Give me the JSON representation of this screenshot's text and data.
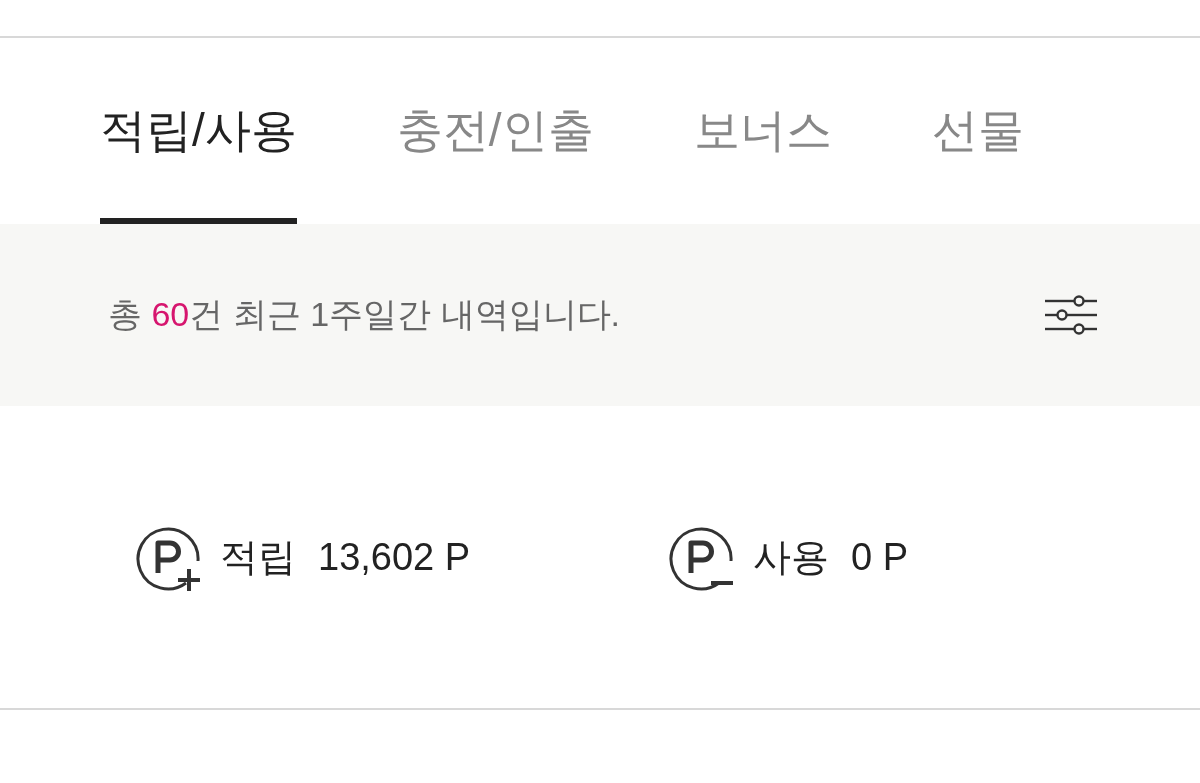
{
  "tabs": [
    {
      "label": "적립/사용",
      "selected": true
    },
    {
      "label": "충전/인출",
      "selected": false
    },
    {
      "label": "보너스",
      "selected": false
    },
    {
      "label": "선물",
      "selected": false
    }
  ],
  "notice": {
    "prefix": "총 ",
    "count": "60",
    "suffix": "건 최근 1주일간 내역입니다."
  },
  "summary": [
    {
      "kind": "plus",
      "label": "적립",
      "value": "13,602 P"
    },
    {
      "kind": "minus",
      "label": "사용",
      "value": "0 P"
    }
  ]
}
